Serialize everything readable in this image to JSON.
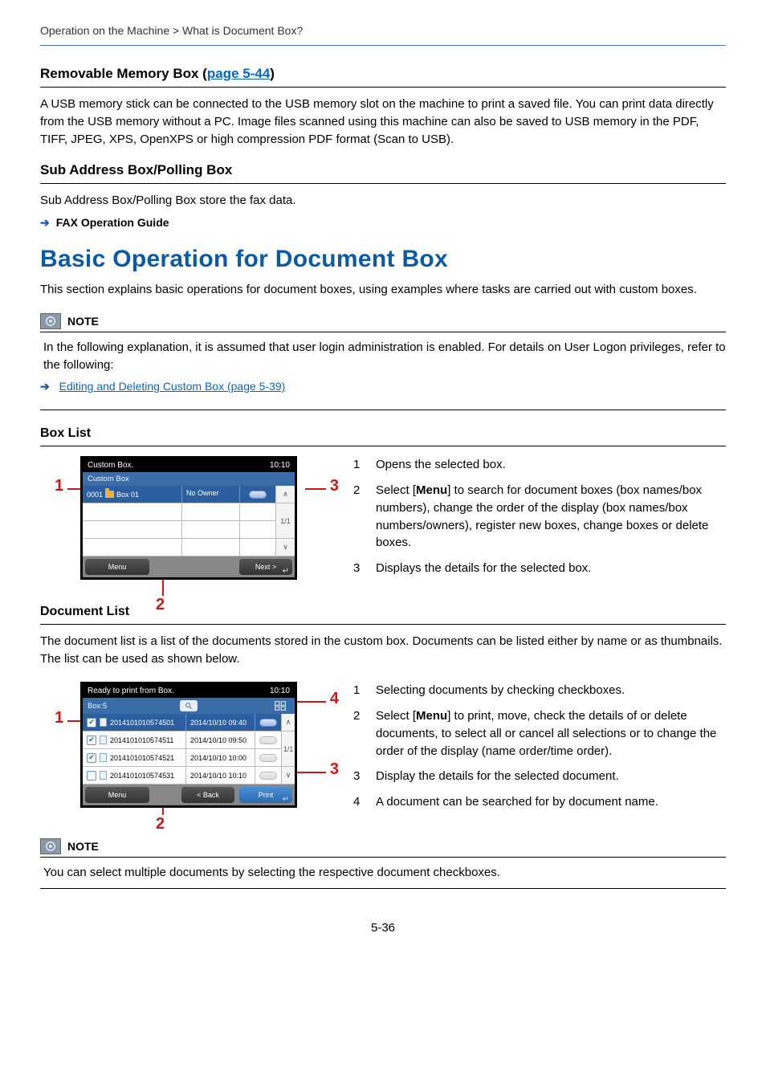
{
  "breadcrumb": "Operation on the Machine > What is Document Box?",
  "rmb": {
    "title_pre": "Removable Memory Box (",
    "title_link": "page 5-44",
    "title_post": ")",
    "body": "A USB memory stick can be connected to the USB memory slot on the machine to print a saved file. You can print data directly from the USB memory without a PC. Image files scanned using this machine can also be saved to USB memory in the PDF, TIFF, JPEG, XPS, OpenXPS or high compression PDF format (Scan to USB)."
  },
  "sab": {
    "title": "Sub Address Box/Polling Box",
    "body": "Sub Address Box/Polling Box store the fax data.",
    "link": "FAX Operation Guide"
  },
  "basic": {
    "h1": "Basic Operation for Document Box",
    "intro": "This section explains basic operations for document boxes, using examples where tasks are carried out with custom boxes."
  },
  "note1": {
    "label": "NOTE",
    "body": "In the following explanation, it is assumed that user login administration is enabled. For details on User Logon privileges, refer to the following:",
    "link": "Editing and Deleting Custom Box (page 5-39)"
  },
  "boxlist": {
    "heading": "Box List",
    "screen": {
      "title": "Custom Box.",
      "time": "10:10",
      "subtitle": "Custom Box",
      "row": {
        "num": "0001",
        "name": "Box 01",
        "owner": "No Owner"
      },
      "page": "1/1",
      "menu": "Menu",
      "next": "Next >"
    },
    "callouts": {
      "1": "Opens the selected box.",
      "2a": "Select [",
      "2b": "Menu",
      "2c": "] to search for document boxes (box names/box numbers), change the order of the display (box names/box numbers/owners), register new boxes, change boxes or delete boxes.",
      "3": "Displays the details for the selected box."
    }
  },
  "doclist": {
    "heading": "Document List",
    "intro": "The document list is a list of the documents stored in the custom box. Documents can be listed either by name or as thumbnails. The list can be used as shown below.",
    "screen": {
      "title": "Ready to print from Box.",
      "time": "10:10",
      "subtitle": "Box:5",
      "rows": [
        {
          "name": "2014101010574501",
          "ts": "2014/10/10 09:40",
          "sel": true,
          "chk": true
        },
        {
          "name": "2014101010574511",
          "ts": "2014/10/10 09:50",
          "sel": false,
          "chk": true
        },
        {
          "name": "2014101010574521",
          "ts": "2014/10/10 10:00",
          "sel": false,
          "chk": true
        },
        {
          "name": "2014101010574531",
          "ts": "2014/10/10 10:10",
          "sel": false,
          "chk": false
        }
      ],
      "page": "1/1",
      "menu": "Menu",
      "back": "< Back",
      "print": "Print"
    },
    "callouts": {
      "1": "Selecting documents by checking checkboxes.",
      "2a": "Select [",
      "2b": "Menu",
      "2c": "] to print, move, check the details of or delete documents, to select all or cancel all selections or to change the order of the display (name order/time order).",
      "3": "Display the details for the selected document.",
      "4": "A document can be searched for by document name."
    }
  },
  "note2": {
    "label": "NOTE",
    "body": "You can select multiple documents by selecting the respective document checkboxes."
  },
  "pagenum": "5-36"
}
